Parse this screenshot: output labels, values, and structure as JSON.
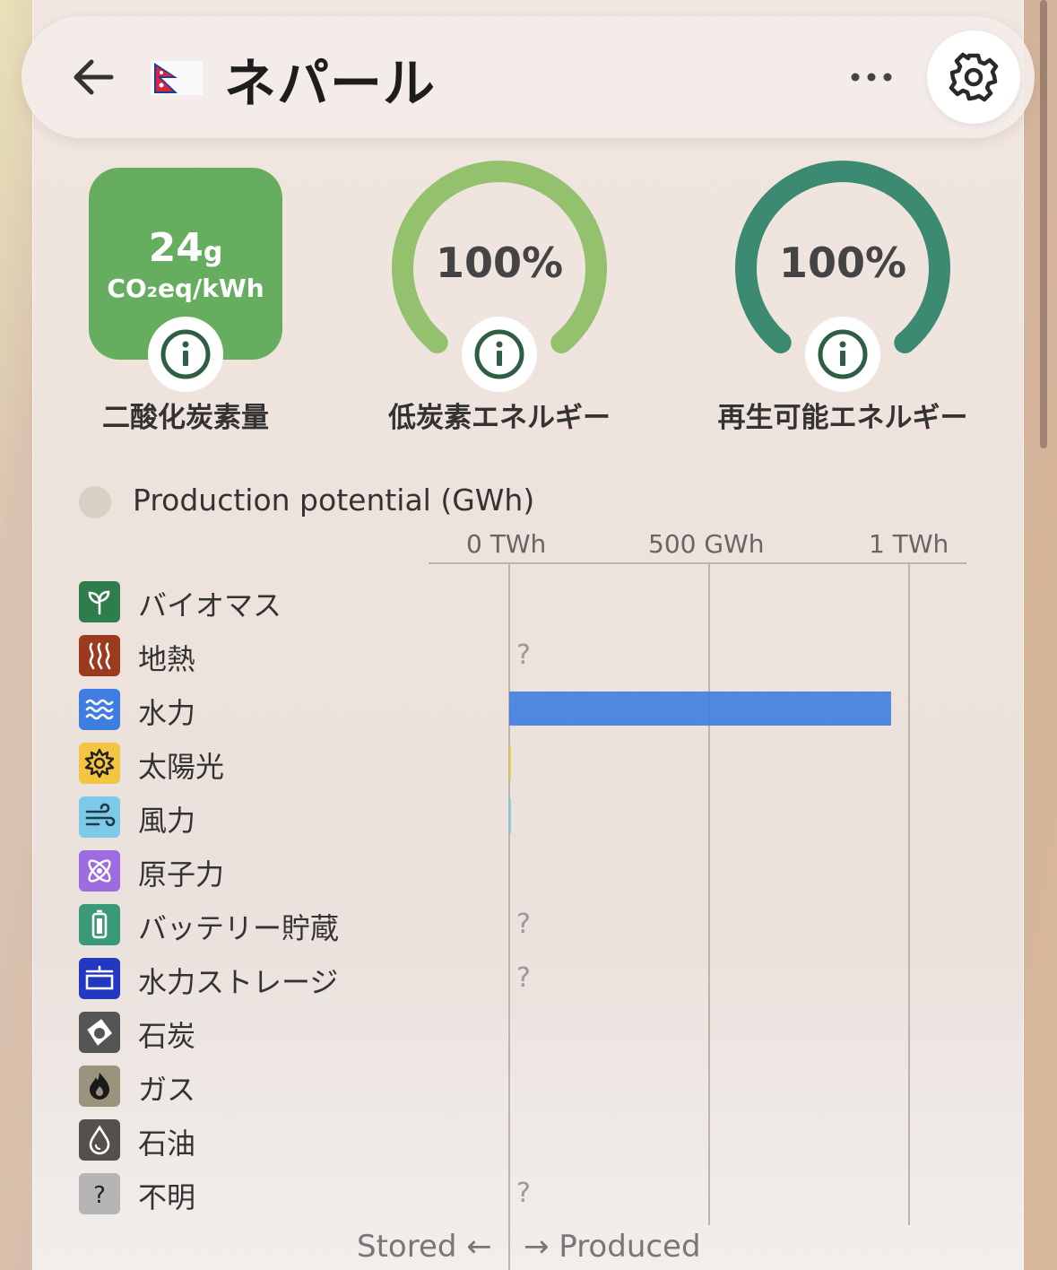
{
  "header": {
    "title": "ネパール",
    "back_icon": "arrow-left-icon",
    "flag_icon": "nepal-flag-icon",
    "more_icon": "more-horizontal-icon",
    "settings_icon": "gear-icon"
  },
  "metrics": {
    "carbon": {
      "value": "24",
      "unit_small": "g",
      "unit_line": "CO₂eq/kWh",
      "label": "二酸化炭素量",
      "color": "#67ad60"
    },
    "low_carbon": {
      "value": "100%",
      "percent": 100,
      "label": "低炭素エネルギー",
      "color": "#94c16e"
    },
    "renewable": {
      "value": "100%",
      "percent": 100,
      "label": "再生可能エネルギー",
      "color": "#3d8a72"
    }
  },
  "chart_legend": {
    "label": "Production potential (GWh)",
    "color": "#d9d0c4"
  },
  "chart_data": {
    "type": "bar",
    "title": "Production potential (GWh)",
    "axis_ticks": [
      "0 TWh",
      "500 GWh",
      "1 TWh"
    ],
    "xlim": [
      0,
      1000
    ],
    "categories": [
      "バイオマス",
      "地熱",
      "水力",
      "太陽光",
      "風力",
      "原子力",
      "バッテリー貯蔵",
      "水力ストレージ",
      "石炭",
      "ガス",
      "石油",
      "不明"
    ],
    "values": [
      0,
      null,
      955,
      2,
      1,
      0,
      null,
      null,
      0,
      0,
      0,
      null
    ],
    "missing_marker": "?",
    "colors": [
      "#2f7d4a",
      "#9c3a1d",
      "#3f7ee0",
      "#f4c542",
      "#7ec8e8",
      "#9c6ce0",
      "#3a9a78",
      "#2238c0",
      "#555555",
      "#9a947f",
      "#55504d",
      "#b5b5b5"
    ]
  },
  "rows": [
    {
      "label": "バイオマス",
      "icon": "sprout-icon",
      "color": "#2f7d4a"
    },
    {
      "label": "地熱",
      "icon": "heat-waves-icon",
      "color": "#9c3a1d"
    },
    {
      "label": "水力",
      "icon": "water-waves-icon",
      "color": "#3f7ee0"
    },
    {
      "label": "太陽光",
      "icon": "sun-icon",
      "color": "#f4c542"
    },
    {
      "label": "風力",
      "icon": "wind-icon",
      "color": "#7ec8e8"
    },
    {
      "label": "原子力",
      "icon": "atom-icon",
      "color": "#9c6ce0"
    },
    {
      "label": "バッテリー貯蔵",
      "icon": "battery-icon",
      "color": "#3a9a78"
    },
    {
      "label": "水力ストレージ",
      "icon": "dam-icon",
      "color": "#2238c0"
    },
    {
      "label": "石炭",
      "icon": "coal-icon",
      "color": "#555555"
    },
    {
      "label": "ガス",
      "icon": "flame-icon",
      "color": "#9a947f"
    },
    {
      "label": "石油",
      "icon": "oil-drop-icon",
      "color": "#55504d"
    },
    {
      "label": "不明",
      "icon": "question-icon",
      "color": "#b5b5b5"
    }
  ],
  "footer": {
    "stored": "Stored ←",
    "produced": "→ Produced"
  }
}
